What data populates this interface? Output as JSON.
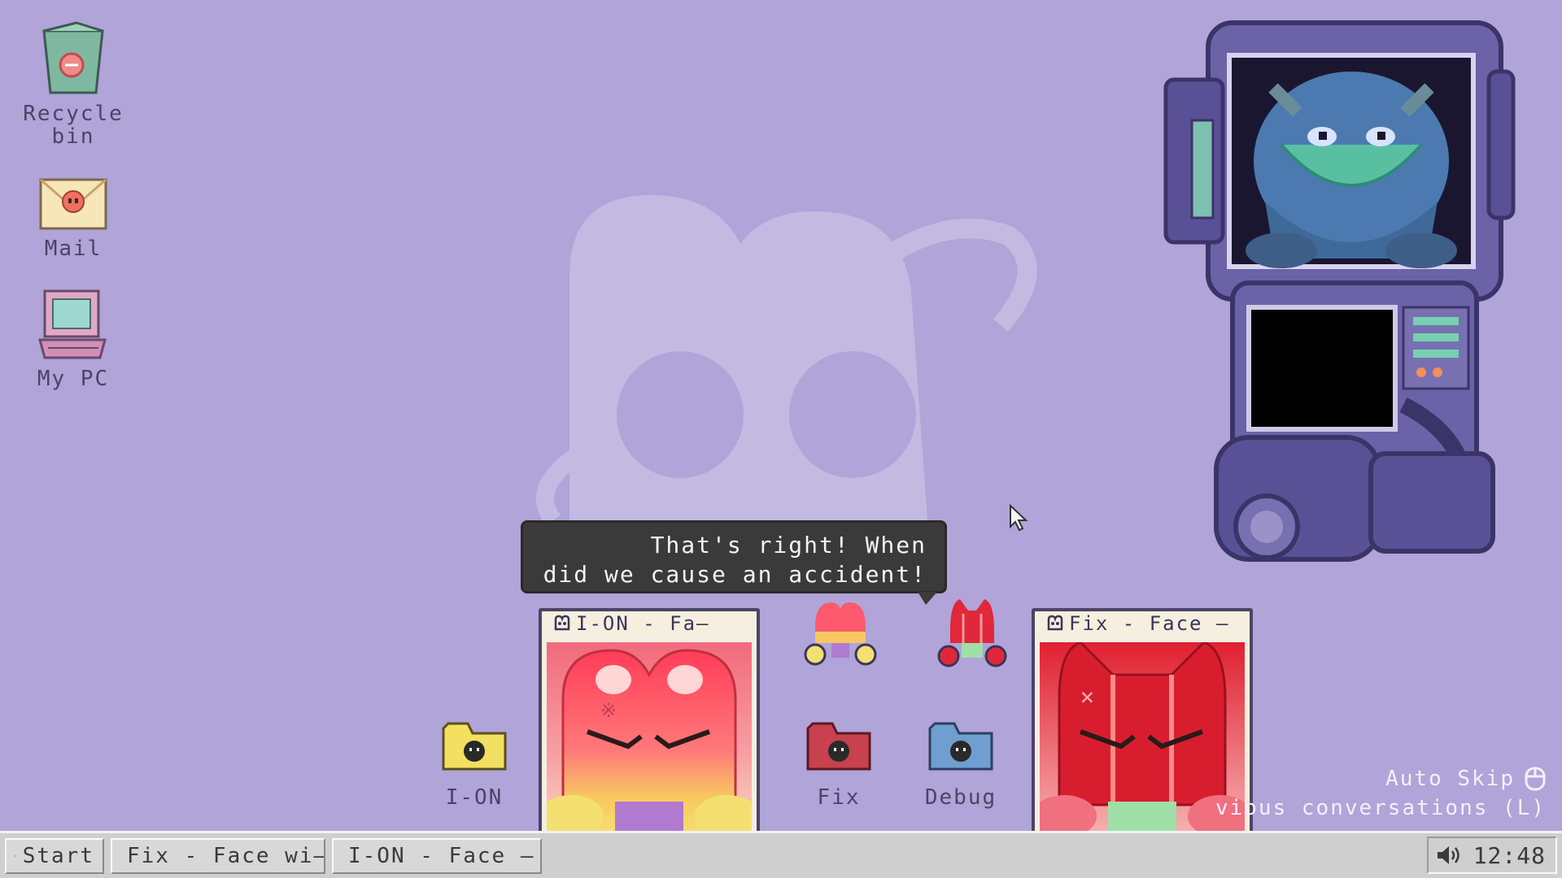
{
  "desktop": {
    "icons": [
      {
        "label": "Recycle bin",
        "icon": "recycle-bin-icon"
      },
      {
        "label": "Mail",
        "icon": "mail-icon"
      },
      {
        "label": "My PC",
        "icon": "computer-icon"
      }
    ]
  },
  "dialogue": {
    "text_line1": "That's right! When",
    "text_line2": "did we cause an accident!"
  },
  "windows": {
    "ion_face": {
      "title": "I-ON - Fa–"
    },
    "fix_face": {
      "title": "Fix - Face –"
    }
  },
  "folders": [
    {
      "label": "I-ON",
      "color": "#f3e060"
    },
    {
      "label": "Fix",
      "color": "#c9404f"
    },
    {
      "label": "Debug",
      "color": "#6f9fd0"
    }
  ],
  "autoskip": {
    "label": "Auto Skip",
    "hint": "vious conversations (L)"
  },
  "taskbar": {
    "start_label": "Start",
    "tasks": [
      {
        "label": "Fix - Face wi–"
      },
      {
        "label": "I-ON - Face –"
      }
    ],
    "clock": "12:48"
  },
  "colors": {
    "background": "#b0a4d8",
    "ion_accent": "#ff5a6e",
    "fix_accent": "#d81e2e"
  }
}
